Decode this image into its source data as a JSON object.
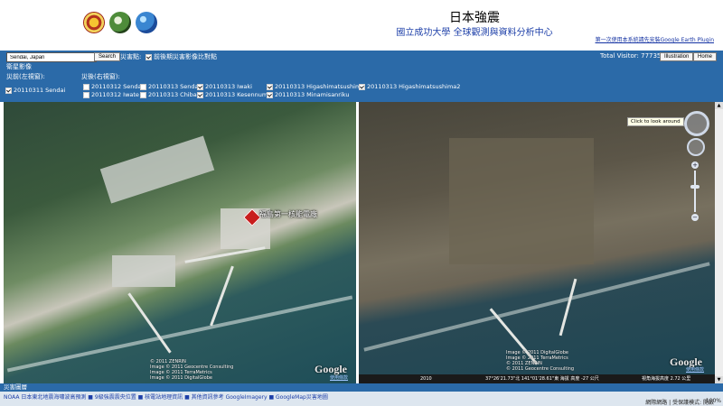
{
  "header": {
    "title": "日本強震",
    "subtitle": "國立成功大學 全球觀測與資料分析中心",
    "plugin_link": "第一次使用本系統請先安裝Google Earth Plugin"
  },
  "controls": {
    "search_value": "Sendai, Japan",
    "search_button": "Search",
    "disaster_label": "災害點:",
    "compare_check": "前後期災害影像比對點",
    "total_visitor": "Total Visitor: 77735",
    "illustration_button": "Illustration",
    "home_button": "Home",
    "satellite_label": "衛星影像",
    "pre_label": "災前(左視窗):",
    "post_label": "災後(右視窗):",
    "pre_options": [
      {
        "label": "20110311 Sendai",
        "checked": true
      }
    ],
    "post_options": [
      {
        "label": "20110312 Sendai",
        "checked": false
      },
      {
        "label": "20110313 Sendai",
        "checked": false
      },
      {
        "label": "20110313 Iwaki",
        "checked": true
      },
      {
        "label": "20110313 Higashimatsushima",
        "checked": true
      },
      {
        "label": "20110313 Higashimatsushima2",
        "checked": true
      },
      {
        "label": "20110312 Iwate",
        "checked": false
      },
      {
        "label": "20110313 Chiba",
        "checked": false
      },
      {
        "label": "20110313 Kesennuma",
        "checked": true
      },
      {
        "label": "20110313 Minamisanriku",
        "checked": true
      }
    ]
  },
  "map_left": {
    "marker_label": "福島第一核能電廠",
    "copyright": "© 2011 ZENRIN\nImage © 2011 Geocentre Consulting\nImage © 2011 TerraMetrics\nImage © 2011 DigitalGlobe",
    "google_logo": "Google",
    "terms": "使用條款"
  },
  "map_right": {
    "tooltip": "Click to look around",
    "copyright": "Image © 2011 DigitalGlobe\nImage © 2011 TerraMetrics\n© 2011 ZENRIN\n© 2011 Geocentre Consulting",
    "google_logo": "Google",
    "terms": "使用條款",
    "year": "2010",
    "status_coords": "37°26'21.73\"北 141°01'28.61\"東 海拔 高度 -27 公尺",
    "status_view": "視角海拔高度 2.72 公里"
  },
  "footer": {
    "title": "災害圖層",
    "layer_links": "NOAA 日本東北地震海嘯波高預測 ■ 9級強震震央位置 ■ 核電站地理資訊 ■ 其他資訊參考 GoogleImagery ■ GoogleMap災害地圖",
    "browser_status": "網際網路 | 受保護模式: 開啟",
    "zoom_level": "100%"
  },
  "colors": {
    "bar": "#2b6aa8",
    "link": "#1d3fa8",
    "marker": "#c81d1d"
  }
}
